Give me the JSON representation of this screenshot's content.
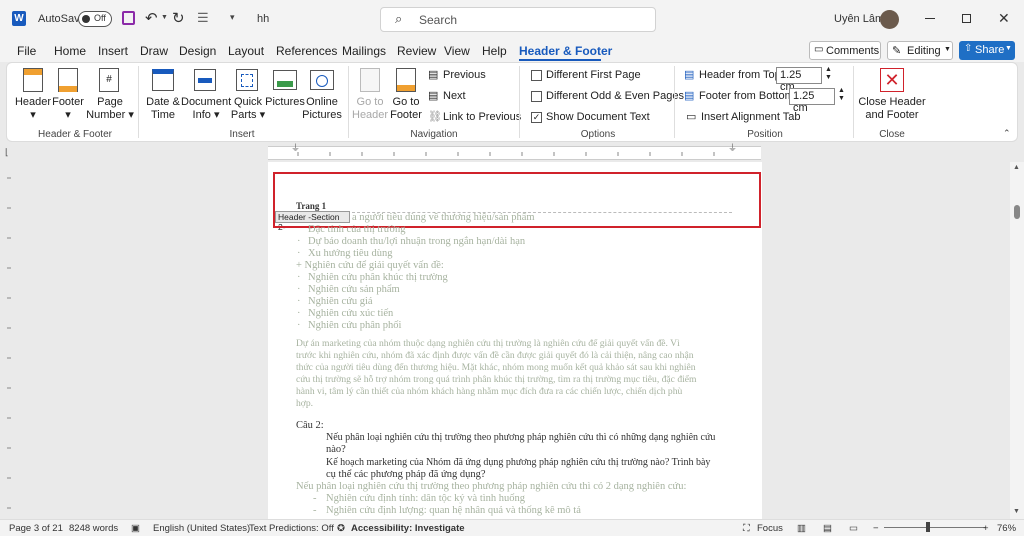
{
  "titlebar": {
    "autosave_label": "AutoSave",
    "autosave_state": "Off",
    "doc_name": "hh",
    "search_placeholder": "Search",
    "user_name": "Uyên Lâm"
  },
  "menu": {
    "tabs": [
      "File",
      "Home",
      "Insert",
      "Draw",
      "Design",
      "Layout",
      "References",
      "Mailings",
      "Review",
      "View",
      "Help",
      "Header & Footer"
    ],
    "active": "Header & Footer",
    "comments": "Comments",
    "editing": "Editing",
    "share": "Share"
  },
  "ribbon": {
    "header": "Header",
    "footer": "Footer",
    "page_number_1": "Page",
    "page_number_2": "Number",
    "group_hf": "Header & Footer",
    "date_time_1": "Date &",
    "date_time_2": "Time",
    "doc_info_1": "Document",
    "doc_info_2": "Info",
    "quick_parts_1": "Quick",
    "quick_parts_2": "Parts",
    "pictures": "Pictures",
    "online_pictures_1": "Online",
    "online_pictures_2": "Pictures",
    "group_insert": "Insert",
    "goto_header_1": "Go to",
    "goto_header_2": "Header",
    "goto_footer_1": "Go to",
    "goto_footer_2": "Footer",
    "previous": "Previous",
    "next": "Next",
    "link_to_previous": "Link to Previous",
    "group_navigation": "Navigation",
    "different_first_page": "Different First Page",
    "different_odd_even": "Different Odd & Even Pages",
    "show_document_text": "Show Document Text",
    "group_options": "Options",
    "header_from_top_label": "Header from Top:",
    "header_from_top_value": "1.25 cm",
    "footer_from_bottom_label": "Footer from Bottom:",
    "footer_from_bottom_value": "1.25 cm",
    "insert_alignment_tab": "Insert Alignment Tab",
    "group_position": "Position",
    "close_1": "Close Header",
    "close_2": "and Footer",
    "group_close": "Close"
  },
  "document": {
    "header_text": "Trang 1",
    "header_tag": "Header -Section 2-",
    "lines": [
      "a người tiêu dùng về thương hiệu/sản phẩm",
      "Đặc tính của thị trường",
      "Dự báo doanh thu/lợi nhuận trong ngắn hạn/dài hạn",
      "Xu hướng tiêu dùng",
      "+ Nghiên cứu để giải quyết vấn đề:",
      "Nghiên cứu phân khúc thị trường",
      "Nghiên cứu sản phẩm",
      "Nghiên cứu giá",
      "Nghiên cứu xúc tiến",
      "Nghiên cứu phân phối"
    ],
    "paragraph": [
      "Dự án marketing của nhóm thuộc dạng nghiên cứu thị trường là nghiên cứu để giải quyết vấn đề. Vì",
      "trước khi nghiên cứu, nhóm đã xác định được vấn đề cần được giải quyết đó là cải thiện, nâng cao nhận",
      "thức của người tiêu dùng đến thương hiệu. Mặt khác, nhóm mong muốn kết quả khảo sát sau khi nghiên",
      "cứu thị trường sẽ hỗ trợ nhóm trong quá trình phân khúc thị trường, tìm ra thị trường mục tiêu, đặc điểm",
      "hành vi, tâm lý cần thiết của nhóm khách hàng nhằm mục đích đưa ra các chiến lược, chiến dịch phù",
      "hợp."
    ],
    "cau2": "Câu 2:",
    "q1a": "Nếu phân loại nghiên cứu thị trường theo phương pháp nghiên cứu thì có những dạng nghiên cứu",
    "q1b": "nào?",
    "q2a": "Kế hoạch marketing của Nhóm đã ứng dụng phương pháp nghiên cứu thị trường nào? Trình bày",
    "q2b": "cụ thể các phương pháp đã ứng dụng?",
    "ans": "Nếu phân loại nghiên cứu thị trường theo phương pháp nghiên cứu thì có 2 dạng nghiên cứu:",
    "b1": "Nghiên cứu định tính: dân tộc ký và tình huống",
    "b2": "Nghiên cứu định lượng: quan hệ nhân quả và thống kê mô tả"
  },
  "status": {
    "page": "Page 3 of 21",
    "words": "8248 words",
    "language": "English (United States)",
    "predictions": "Text Predictions: Off",
    "accessibility": "Accessibility: Investigate",
    "focus": "Focus",
    "zoom": "76%"
  },
  "colors": {
    "accent": "#185abd",
    "highlight_border": "#d0222b",
    "share_bg": "#1f6fc5"
  }
}
